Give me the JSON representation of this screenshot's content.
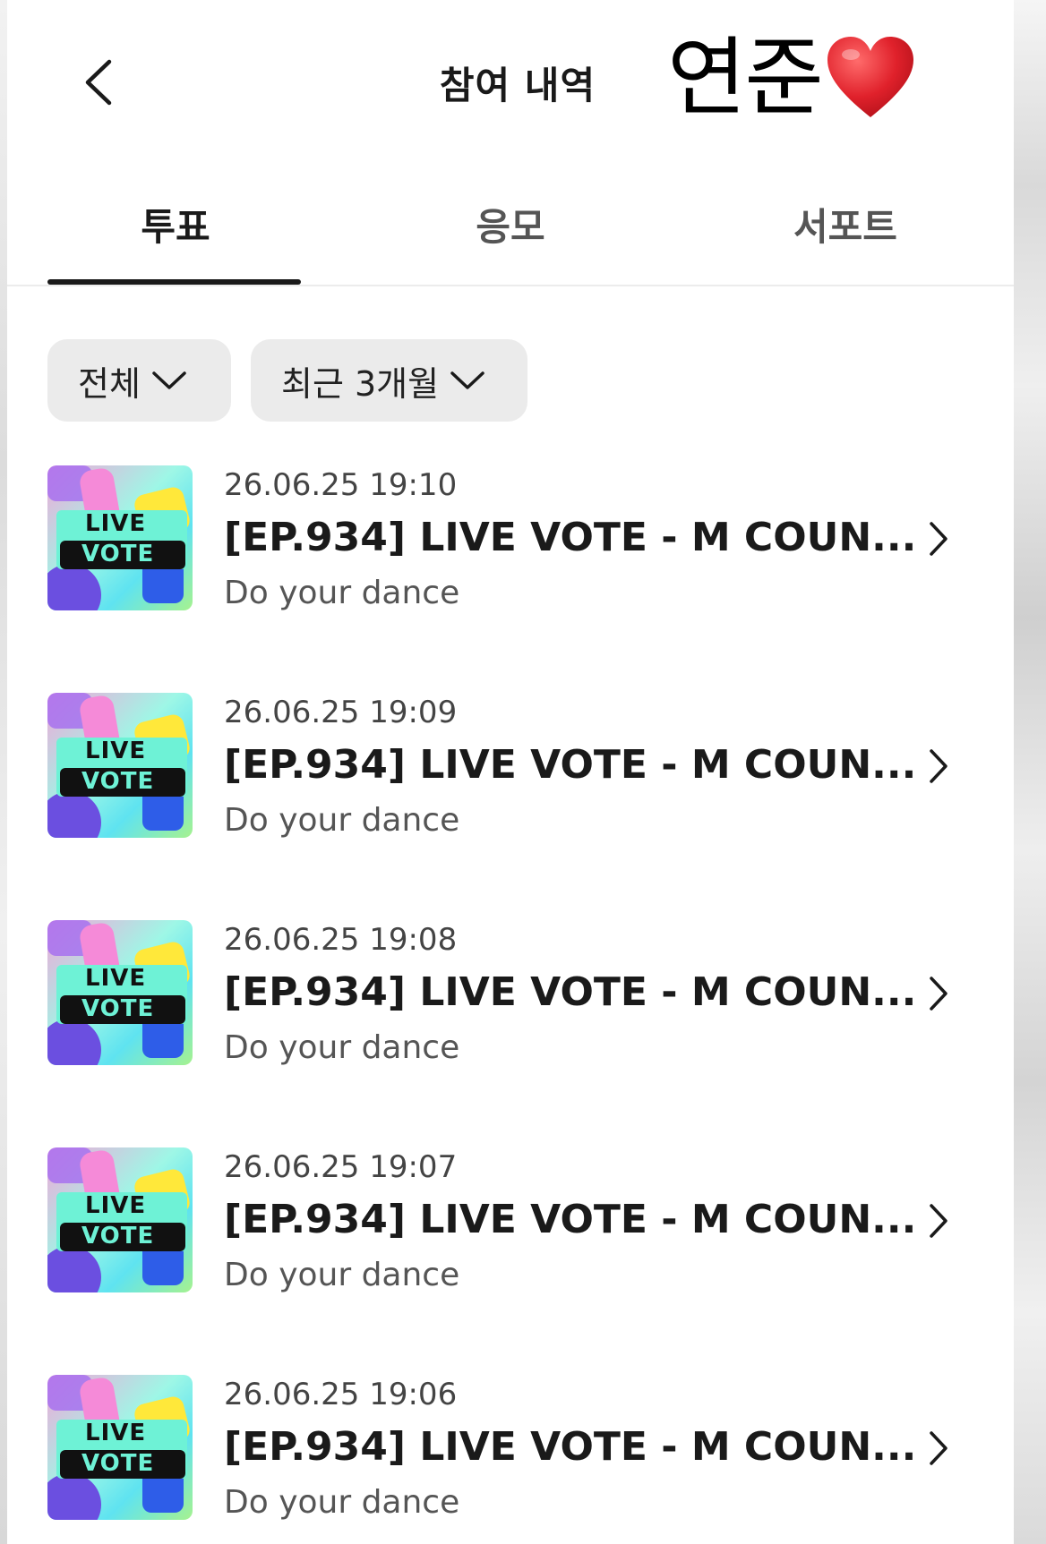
{
  "header": {
    "title": "참여 내역",
    "sticker_text": "연준",
    "back_icon": "chevron-left-icon",
    "heart_icon": "red-heart-icon"
  },
  "tabs": [
    {
      "label": "투표",
      "active": true
    },
    {
      "label": "응모",
      "active": false
    },
    {
      "label": "서포트",
      "active": false
    }
  ],
  "filters": [
    {
      "label": "전체",
      "icon": "chevron-down-icon"
    },
    {
      "label": "최근 3개월",
      "icon": "chevron-down-icon"
    }
  ],
  "items": [
    {
      "date": "26.06.25 19:10",
      "title": "[EP.934] LIVE VOTE - M COUN...",
      "subtitle": "Do your dance",
      "thumb_line1": "LIVE",
      "thumb_line2": "VOTE"
    },
    {
      "date": "26.06.25 19:09",
      "title": "[EP.934] LIVE VOTE - M COUN...",
      "subtitle": "Do your dance",
      "thumb_line1": "LIVE",
      "thumb_line2": "VOTE"
    },
    {
      "date": "26.06.25 19:08",
      "title": "[EP.934] LIVE VOTE - M COUN...",
      "subtitle": "Do your dance",
      "thumb_line1": "LIVE",
      "thumb_line2": "VOTE"
    },
    {
      "date": "26.06.25 19:07",
      "title": "[EP.934] LIVE VOTE - M COUN...",
      "subtitle": "Do your dance",
      "thumb_line1": "LIVE",
      "thumb_line2": "VOTE"
    },
    {
      "date": "26.06.25 19:06",
      "title": "[EP.934] LIVE VOTE - M COUN...",
      "subtitle": "Do your dance",
      "thumb_line1": "LIVE",
      "thumb_line2": "VOTE"
    }
  ],
  "colors": {
    "accent": "#1a1a1a",
    "filter_bg": "#ebebeb",
    "heart": "#e0212b"
  }
}
